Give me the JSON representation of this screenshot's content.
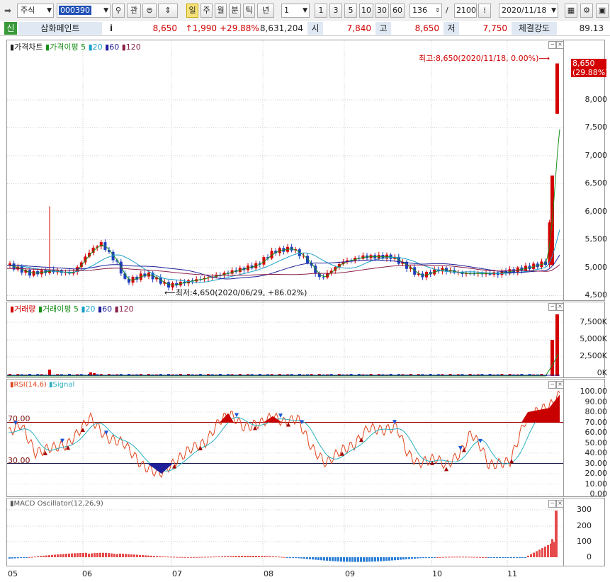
{
  "toolbar": {
    "market": "주식",
    "code": "000390",
    "search_icon": "search-icon",
    "related_btn": "관",
    "period_buttons": [
      "일",
      "주",
      "월",
      "분",
      "틱",
      "년"
    ],
    "interval_value": "1",
    "interval_buttons": [
      "1",
      "3",
      "5",
      "10",
      "30",
      "60"
    ],
    "count": "136",
    "total": "2100",
    "slash": "/",
    "date": "2020/11/18"
  },
  "quote": {
    "badge": "신",
    "name": "삼화페인트",
    "info": "i",
    "price": "8,650",
    "change": "↑1,990",
    "change_pct": "+29.88%",
    "volume": "8,631,204",
    "open_label": "시",
    "open": "7,840",
    "high_label": "고",
    "high": "8,650",
    "low_label": "저",
    "low": "7,750",
    "strength_label": "체결강도",
    "strength": "89.13"
  },
  "price_panel": {
    "title": "가격차트",
    "ma_label": "가격이평",
    "ma": [
      "5",
      "20",
      "60",
      "120"
    ],
    "ma_colors": [
      "#1a8f1a",
      "#19a0c8",
      "#1f1f9a",
      "#8b1f4a"
    ],
    "high_note": "최고:8,650(2020/11/18, 0.00%)",
    "low_note": "최저:4,650(2020/06/29, +86.02%)",
    "last_price": "8,650",
    "last_pct": "(29.88%)",
    "y_ticks": [
      "8,000",
      "7,500",
      "7,000",
      "6,500",
      "6,000",
      "5,500",
      "5,000",
      "4,500"
    ]
  },
  "volume_panel": {
    "title": "거래량",
    "ma_label": "거래이평",
    "ma": [
      "5",
      "20",
      "60",
      "120"
    ],
    "y_ticks": [
      "7,500K",
      "5,000K",
      "2,500K",
      "0K"
    ]
  },
  "rsi_panel": {
    "title": "RSI(14,6)",
    "signal": "Signal",
    "level_high": "70.00",
    "level_low": "30.00",
    "y_ticks": [
      "100.00",
      "90.00",
      "80.00",
      "70.00",
      "60.00",
      "50.00",
      "40.00",
      "30.00",
      "20.00",
      "10.00",
      "0.00"
    ]
  },
  "macd_panel": {
    "title": "MACD Oscillator(12,26,9)",
    "y_ticks": [
      "300",
      "200",
      "100",
      "0"
    ]
  },
  "x_axis": {
    "months": [
      "05",
      "06",
      "07",
      "08",
      "09",
      "10",
      "11"
    ]
  },
  "colors": {
    "up": "#d40000",
    "down": "#1f3fbf",
    "rsi": "#e0441c",
    "signal": "#2ab0c0"
  }
}
